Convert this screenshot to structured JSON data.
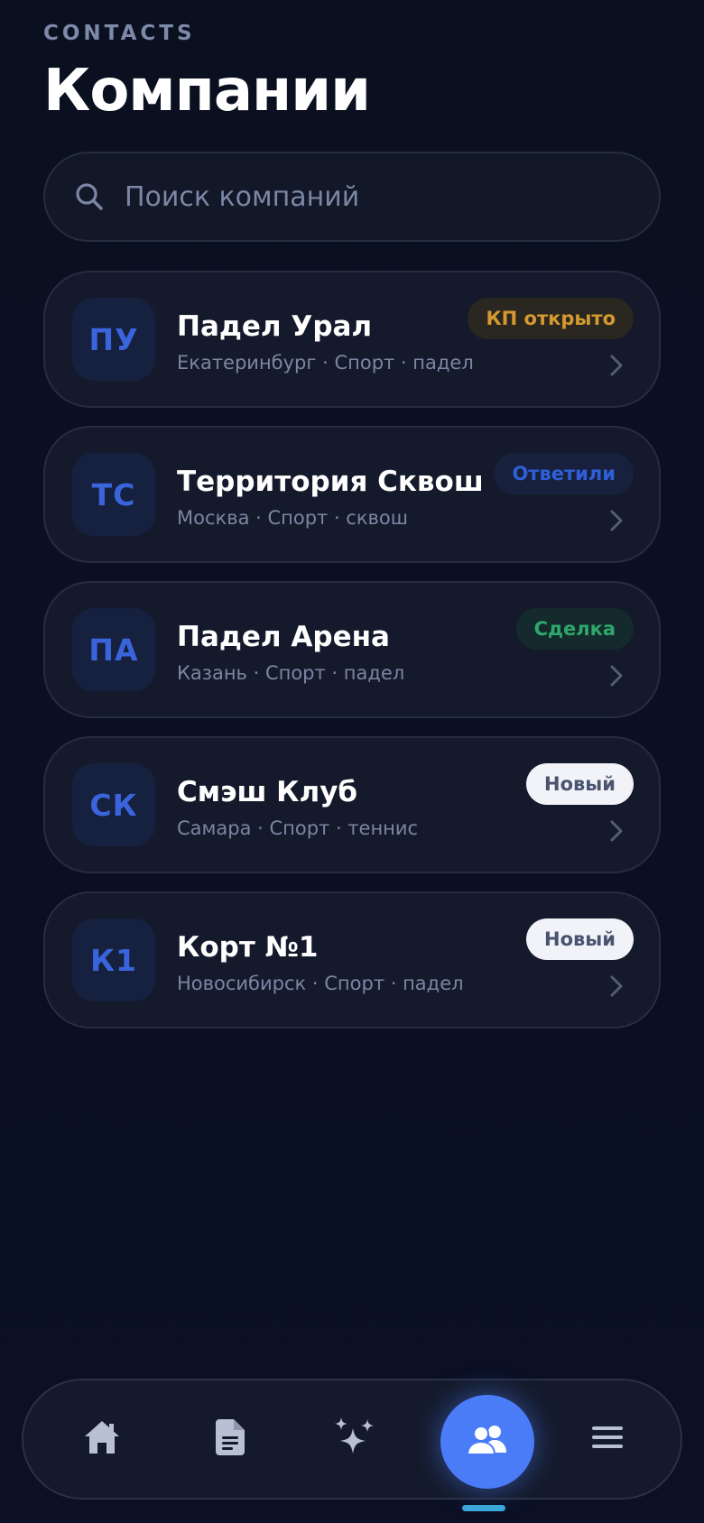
{
  "header": {
    "eyebrow": "CONTACTS",
    "title": "Компании"
  },
  "search": {
    "placeholder": "Поиск компаний"
  },
  "companies": [
    {
      "initials": "ПУ",
      "name": "Падел Урал",
      "subtitle": "Екатеринбург · Спорт · падел",
      "status": "КП открыто",
      "status_kind": "kp"
    },
    {
      "initials": "ТС",
      "name": "Территория Сквош",
      "subtitle": "Москва · Спорт · сквош",
      "status": "Ответили",
      "status_kind": "answered"
    },
    {
      "initials": "ПА",
      "name": "Падел Арена",
      "subtitle": "Казань · Спорт · падел",
      "status": "Сделка",
      "status_kind": "deal"
    },
    {
      "initials": "СК",
      "name": "Смэш Клуб",
      "subtitle": "Самара · Спорт · теннис",
      "status": "Новый",
      "status_kind": "new"
    },
    {
      "initials": "К1",
      "name": "Корт №1",
      "subtitle": "Новосибирск · Спорт · падел",
      "status": "Новый",
      "status_kind": "new"
    }
  ],
  "nav": {
    "items": [
      {
        "icon": "home-icon"
      },
      {
        "icon": "document-icon"
      },
      {
        "icon": "sparkles-icon"
      },
      {
        "icon": "users-icon",
        "active": true
      },
      {
        "icon": "menu-icon"
      }
    ]
  },
  "colors": {
    "background": "#0a1020",
    "accent": "#4a7cf7",
    "status_kp": "#d49a30",
    "status_answered": "#2f5fd8",
    "status_deal": "#2ea86a"
  }
}
